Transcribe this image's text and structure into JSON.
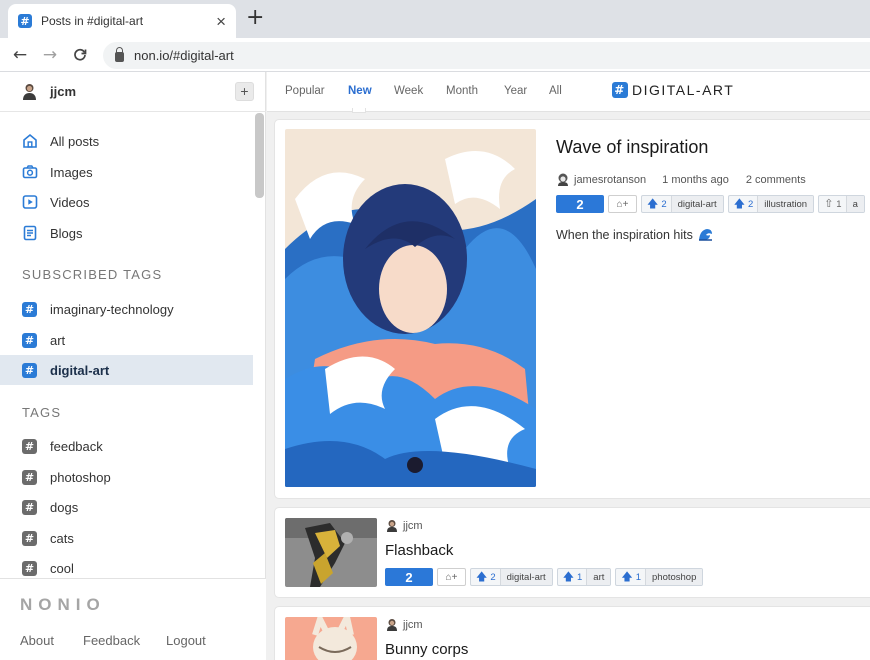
{
  "browser": {
    "tab_title": "Posts in #digital-art",
    "tab_close": "×",
    "new_tab": "+",
    "favicon_glyph": "#",
    "url": "non.io/#digital-art",
    "back": "←",
    "forward": "→",
    "reload": "C"
  },
  "sidebar": {
    "username": "jjcm",
    "add_button": "+",
    "nav": [
      {
        "label": "All posts",
        "icon": "home-icon"
      },
      {
        "label": "Images",
        "icon": "camera-icon"
      },
      {
        "label": "Videos",
        "icon": "play-icon"
      },
      {
        "label": "Blogs",
        "icon": "document-icon"
      }
    ],
    "subscribed_heading": "SUBSCRIBED TAGS",
    "subscribed_tags": [
      "imaginary-technology",
      "art",
      "digital-art"
    ],
    "active_tag": "digital-art",
    "tags_heading": "TAGS",
    "tags": [
      "feedback",
      "photoshop",
      "dogs",
      "cats",
      "cool"
    ],
    "hash_glyph": "#",
    "brand": "NONIO",
    "footer_links": [
      "About",
      "Feedback",
      "Logout"
    ]
  },
  "topnav": {
    "filters": [
      "Popular",
      "New",
      "Week",
      "Month",
      "Year",
      "All"
    ],
    "active_filter": "New",
    "channel_title": "DIGITAL-ART"
  },
  "posts": [
    {
      "title": "Wave of inspiration",
      "author": "jamesrotanson",
      "time": "1 months ago",
      "comments": "2 comments",
      "score": "2",
      "description": "When the inspiration hits",
      "tag_button": "⌂+",
      "tags": [
        {
          "count": "2",
          "name": "digital-art",
          "voted": true
        },
        {
          "count": "2",
          "name": "illustration",
          "voted": true
        },
        {
          "count": "1",
          "name": "a",
          "voted": false
        }
      ]
    },
    {
      "title": "Flashback",
      "author": "jjcm",
      "score": "2",
      "tag_button": "⌂+",
      "tags": [
        {
          "count": "2",
          "name": "digital-art",
          "voted": true
        },
        {
          "count": "1",
          "name": "art",
          "voted": true
        },
        {
          "count": "1",
          "name": "photoshop",
          "voted": true
        }
      ]
    },
    {
      "title": "Bunny corps",
      "author": "jjcm"
    }
  ],
  "colors": {
    "accent": "#2b78d8",
    "active_tag_bg": "#e1e8f0",
    "tag_blue": "#2b7bd6",
    "tag_gray": "#6b6b6b"
  }
}
